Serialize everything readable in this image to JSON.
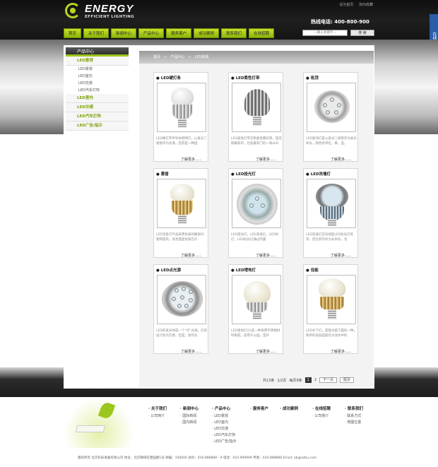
{
  "header": {
    "logo_title": "ENERGY",
    "logo_subtitle": "EFFICIENT LIGHTING",
    "top_links": [
      "设为首页",
      "加为收藏"
    ],
    "hotline": "热线电话: 400-800-900",
    "nav": [
      "首页",
      "关于我们",
      "新闻中心",
      "产品中心",
      "服务客户",
      "成功案例",
      "联系我们",
      "在线招聘"
    ],
    "search_placeholder": "—输入关键字—",
    "search_button": "搜 索",
    "side_float": "在线客服"
  },
  "sidebar": {
    "heading": "产品中心",
    "groups": [
      {
        "label": "LED景观",
        "items": [
          "LED景观",
          "LED室内",
          "LED交通",
          "LED汽车灯饰"
        ]
      },
      {
        "label": "LED室内",
        "items": []
      },
      {
        "label": "LED交通",
        "items": []
      },
      {
        "label": "LED汽车灯饰",
        "items": []
      },
      {
        "label": "LED广告/指示",
        "items": []
      }
    ]
  },
  "breadcrumb": [
    "首页",
    "»",
    "产品中心",
    "»",
    "LED景观"
  ],
  "products": [
    {
      "title": "LED硬灯条",
      "desc": "LED硬灯带半导体照明灯，以发光二极管作为光源，因其是一种固",
      "more": "了解更多......"
    },
    {
      "title": "LED柔性灯带",
      "desc": "LED柔性灯带又称柔性霓虹管，是近期最新的，也是最热门的一款LED",
      "more": "了解更多......"
    },
    {
      "title": "吸顶",
      "desc": "LED吸顶灯是以发光二极管作为发光体光，颜色有单红，黄，蓝，",
      "more": "了解更多......"
    },
    {
      "title": "惠普",
      "desc": "LED流星灯产品采用优质的硬质PC管和铝壳，高亮度超优质芯片",
      "more": "了解更多......"
    },
    {
      "title": "LED投光灯",
      "desc": "LED宽光灯，LED洗墙灯，LED射灯，LED投光灯通过内置",
      "more": "了解更多......"
    },
    {
      "title": "LED洗墙灯",
      "desc": "LED洗墙灯又叫线型LED投光灯等等，因为其外形为长条形，也",
      "more": "了解更多......"
    },
    {
      "title": "LED点光源",
      "desc": "LED的发光体是一个“点”光源，灯具设计较为方便，但是，管作为",
      "more": "了解更多......"
    },
    {
      "title": "LED埋地灯",
      "desc": "LED埋地灯(1)是一种采用不锈钢材料制成，适用于公园，室外",
      "more": "了解更多......"
    },
    {
      "title": "佳能",
      "desc": "LED水下灯，是嵌水面下面的一种，简单的说就是嵌在水池水中的",
      "more": "了解更多......"
    }
  ],
  "pagination": {
    "total": "共13条",
    "page_info": "1/2页",
    "per_page": "每页9条",
    "pages": [
      "1",
      "2"
    ],
    "next": "下一页",
    "last": "尾页"
  },
  "footer": {
    "columns": [
      {
        "heading": "关于我们",
        "items": [
          "公司简介"
        ]
      },
      {
        "heading": "新闻中心",
        "items": [
          "国际新闻",
          "国内新闻"
        ]
      },
      {
        "heading": "产品中心",
        "items": [
          "LED景观",
          "LED室内",
          "LED交通",
          "LED汽车灯饰",
          "LED广告/指示"
        ]
      },
      {
        "heading": "服务客户",
        "items": []
      },
      {
        "heading": "成功案例",
        "items": []
      },
      {
        "heading": "在线招聘",
        "items": [
          "公司简介"
        ]
      },
      {
        "heading": "联系我们",
        "items": [
          "联系方式",
          "地图位置"
        ]
      }
    ],
    "copyright": "版权所有    北京科技发展有限公司 地址：北京朝阳区建国路1号 邮编：100000    总机：010-888888 - 9 电话：010-999999 传真：010-888888 Email: ab@ezbu.com"
  },
  "colors": {
    "accent": "#9cc31a",
    "header_bg": "#1a1a1a"
  }
}
